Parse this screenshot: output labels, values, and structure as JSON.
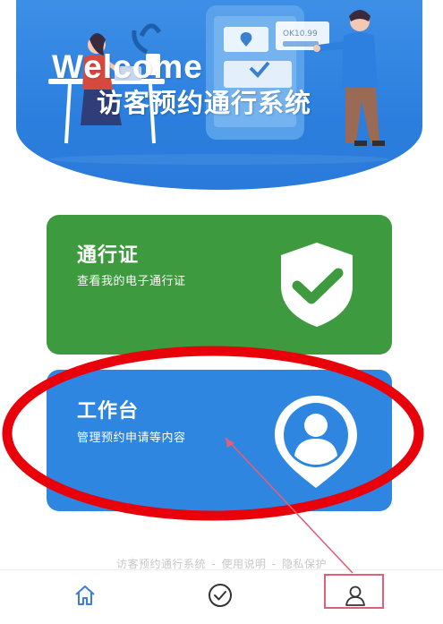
{
  "banner": {
    "welcome_text": "Welcome",
    "system_title": "访客预约通行系统",
    "phone_screen_text": "OK10.99",
    "background_color": "#2c7fde"
  },
  "cards": {
    "pass": {
      "title": "通行证",
      "subtitle": "查看我的电子通行证",
      "icon": "shield-check-icon",
      "color": "#3e9a3f"
    },
    "workbench": {
      "title": "工作台",
      "subtitle": "管理预约申请等内容",
      "icon": "user-location-pin-icon",
      "color": "#2e86e0"
    }
  },
  "footer": {
    "system_link": "访客预约通行系统",
    "separator": "-",
    "manual_link": "使用说明",
    "privacy_link": "隐私保护"
  },
  "tabbar": {
    "items": [
      {
        "name": "home",
        "icon": "home-icon"
      },
      {
        "name": "check",
        "icon": "check-circle-icon"
      },
      {
        "name": "me",
        "icon": "user-icon"
      }
    ]
  },
  "annotation": {
    "ellipse_color": "#e8000b",
    "arrow_color": "#e0607a"
  }
}
